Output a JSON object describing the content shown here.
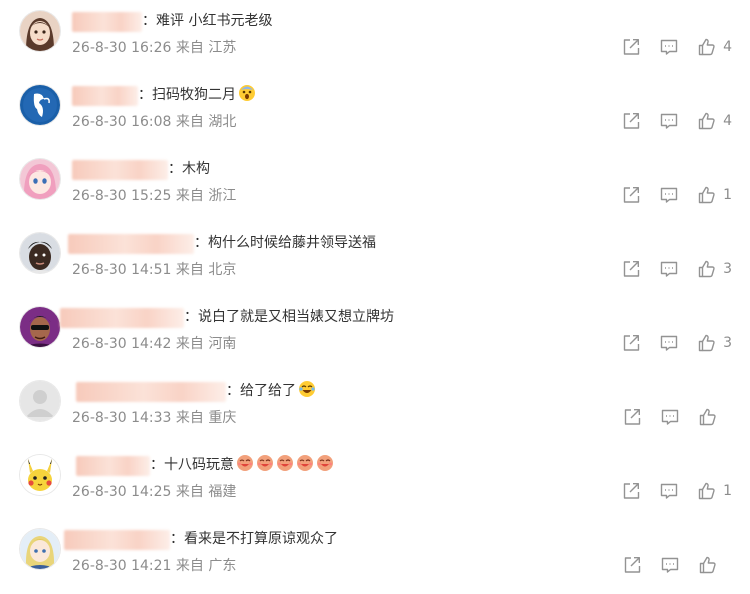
{
  "comments": [
    {
      "text": "：难评  小红书元老级",
      "timestamp": "26-8-30 16:26",
      "location": "来自 江苏",
      "likes": "4"
    },
    {
      "text": "：扫码牧狗二月",
      "timestamp": "26-8-30 16:08",
      "location": "来自 湖北",
      "likes": "4",
      "emoji": "scream-emoji"
    },
    {
      "text": "：木构",
      "timestamp": "26-8-30 15:25",
      "location": "来自 浙江",
      "likes": "1"
    },
    {
      "text": "：构什么时候给藤井领导送福",
      "timestamp": "26-8-30 14:51",
      "location": "来自 北京",
      "likes": "3"
    },
    {
      "text": "：说白了就是又相当婊又想立牌坊",
      "timestamp": "26-8-30 14:42",
      "location": "来自 河南",
      "likes": "3"
    },
    {
      "text": "：给了给了",
      "timestamp": "26-8-30 14:33",
      "location": "来自 重庆",
      "likes": "",
      "emoji": "laugh-cry-emoji"
    },
    {
      "text": "：十八码玩意",
      "timestamp": "26-8-30 14:25",
      "location": "来自 福建",
      "likes": "1",
      "emoji": "shy-face-emoji"
    },
    {
      "text": "：看来是不打算原谅观众了",
      "timestamp": "26-8-30 14:21",
      "location": "来自 广东",
      "likes": ""
    }
  ],
  "icons": {
    "share": "share-icon",
    "comment": "comment-icon",
    "like": "thumbs-up-icon"
  },
  "colors": {
    "text": "#333333",
    "meta": "#8c8c8c",
    "icon": "#939393",
    "name_blur": "#f7cabb"
  }
}
